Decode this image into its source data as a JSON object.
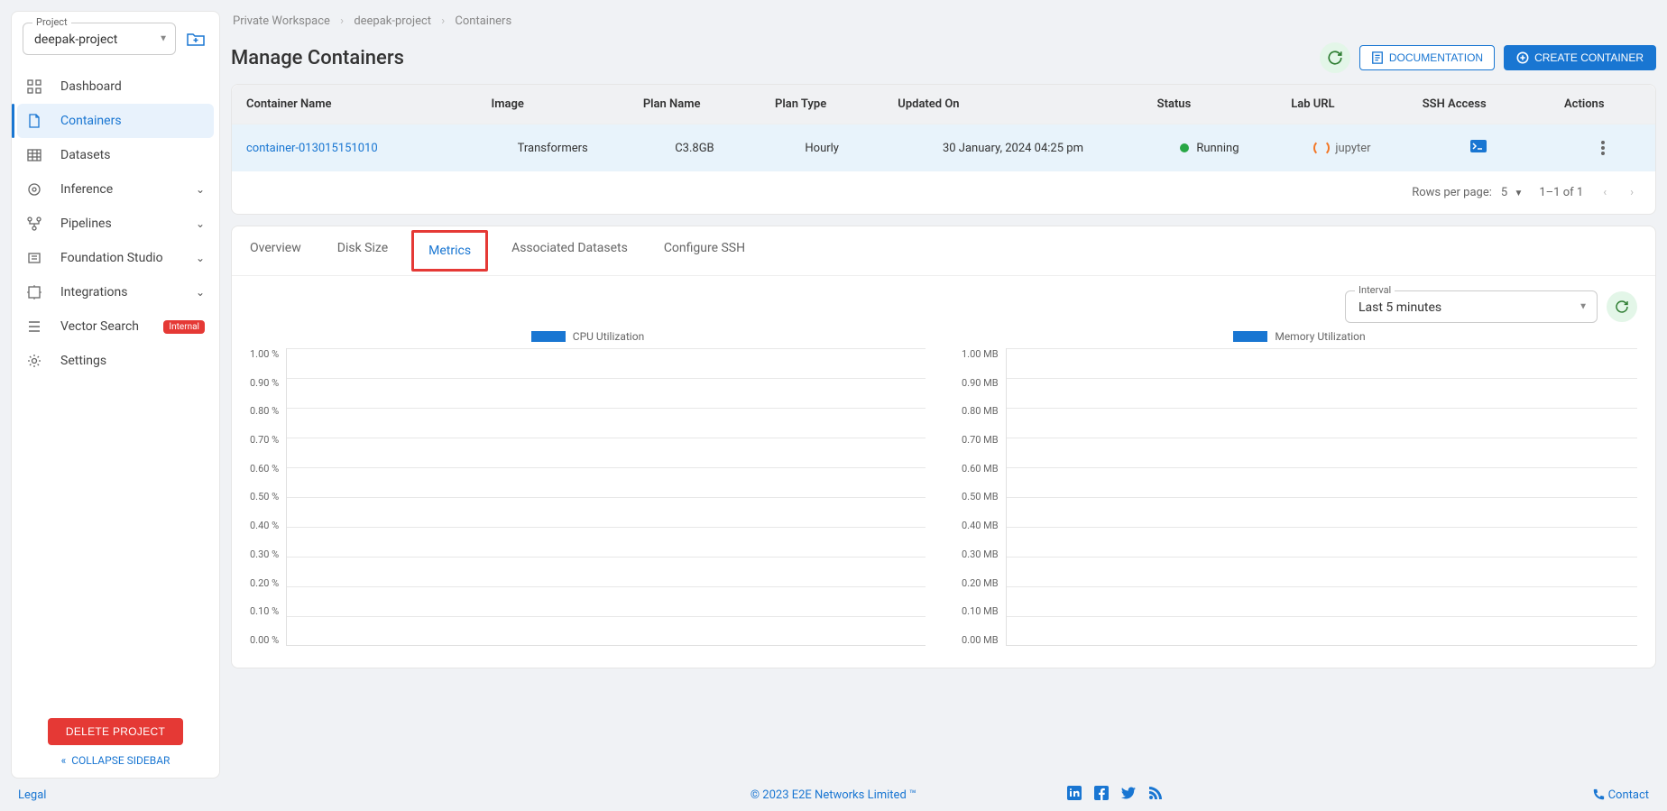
{
  "project": {
    "legend": "Project",
    "name": "deepak-project"
  },
  "sidebar": {
    "items": [
      {
        "label": "Dashboard",
        "icon": "grid"
      },
      {
        "label": "Containers",
        "icon": "file",
        "active": true
      },
      {
        "label": "Datasets",
        "icon": "table"
      },
      {
        "label": "Inference",
        "icon": "target",
        "expandable": true
      },
      {
        "label": "Pipelines",
        "icon": "flow",
        "expandable": true
      },
      {
        "label": "Foundation Studio",
        "icon": "layers",
        "expandable": true
      },
      {
        "label": "Integrations",
        "icon": "plug",
        "expandable": true
      },
      {
        "label": "Vector Search",
        "icon": "list",
        "badge": "Internal"
      },
      {
        "label": "Settings",
        "icon": "gear"
      }
    ],
    "delete_label": "DELETE PROJECT",
    "collapse_label": "COLLAPSE SIDEBAR"
  },
  "breadcrumb": {
    "parts": [
      "Private Workspace",
      "deepak-project",
      "Containers"
    ]
  },
  "page": {
    "title": "Manage Containers",
    "doc_label": "DOCUMENTATION",
    "create_label": "CREATE CONTAINER"
  },
  "table": {
    "headers": [
      "Container Name",
      "Image",
      "Plan Name",
      "Plan Type",
      "Updated On",
      "Status",
      "Lab URL",
      "SSH Access",
      "Actions"
    ],
    "rows": [
      {
        "name": "container-013015151010",
        "image": "Transformers",
        "plan_name": "C3.8GB",
        "plan_type": "Hourly",
        "updated": "30 January, 2024 04:25 pm",
        "status": "Running",
        "lab": "jupyter"
      }
    ],
    "pagination": {
      "rows_per_label": "Rows per page:",
      "rows_per_value": "5",
      "range": "1–1 of 1"
    }
  },
  "tabs": {
    "items": [
      "Overview",
      "Disk Size",
      "Metrics",
      "Associated Datasets",
      "Configure SSH"
    ],
    "active": "Metrics"
  },
  "metrics": {
    "interval_legend": "Interval",
    "interval_value": "Last 5 minutes"
  },
  "chart_data": [
    {
      "type": "line",
      "title": "CPU Utilization",
      "y_ticks": [
        "1.00 %",
        "0.90 %",
        "0.80 %",
        "0.70 %",
        "0.60 %",
        "0.50 %",
        "0.40 %",
        "0.30 %",
        "0.20 %",
        "0.10 %",
        "0.00 %"
      ],
      "ylim": [
        0,
        1
      ],
      "series": [
        {
          "name": "CPU Utilization",
          "values": []
        }
      ]
    },
    {
      "type": "line",
      "title": "Memory Utilization",
      "y_ticks": [
        "1.00 MB",
        "0.90 MB",
        "0.80 MB",
        "0.70 MB",
        "0.60 MB",
        "0.50 MB",
        "0.40 MB",
        "0.30 MB",
        "0.20 MB",
        "0.10 MB",
        "0.00 MB"
      ],
      "ylim": [
        0,
        1
      ],
      "series": [
        {
          "name": "Memory Utilization",
          "values": []
        }
      ]
    }
  ],
  "footer": {
    "legal": "Legal",
    "copyright": "© 2023 E2E Networks Limited ™",
    "contact": "Contact"
  }
}
